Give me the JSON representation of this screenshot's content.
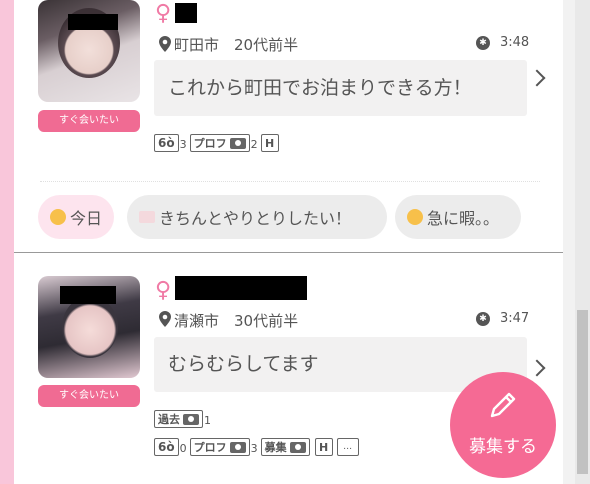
{
  "posts": [
    {
      "wish": "すぐ会いたい",
      "gender": "♀",
      "location": "町田市　20代前半",
      "time": "3:48",
      "message": "これから町田でお泊まりできる方！",
      "tags": {
        "glasses_count": "3",
        "profile_label": "プロフ",
        "profile_count": "2",
        "hotel_label": "H"
      },
      "chips": [
        {
          "label": "今日",
          "emoji": "smiling-face-with-heart-eyes"
        },
        {
          "label": "きちんとやりとりしたい！",
          "emoji": "love-letter"
        },
        {
          "label": "急に暇。。",
          "emoji": "weary-face"
        }
      ]
    },
    {
      "wish": "すぐ会いたい",
      "gender": "♀",
      "location": "清瀬市　30代前半",
      "time": "3:47",
      "message": "むらむらしてます",
      "tags": {
        "past_label": "過去",
        "past_count": "1",
        "glasses_count": "0",
        "profile_label": "プロフ",
        "profile_count": "3",
        "recruit_label": "募集",
        "hotel_label": "H",
        "chat_label": "…"
      }
    }
  ],
  "fab": {
    "label": "募集する",
    "icon": "pencil-icon"
  },
  "glasses_glyph": "6ò",
  "colors": {
    "accent": "#f56a94",
    "rail": "#f9c6da"
  }
}
